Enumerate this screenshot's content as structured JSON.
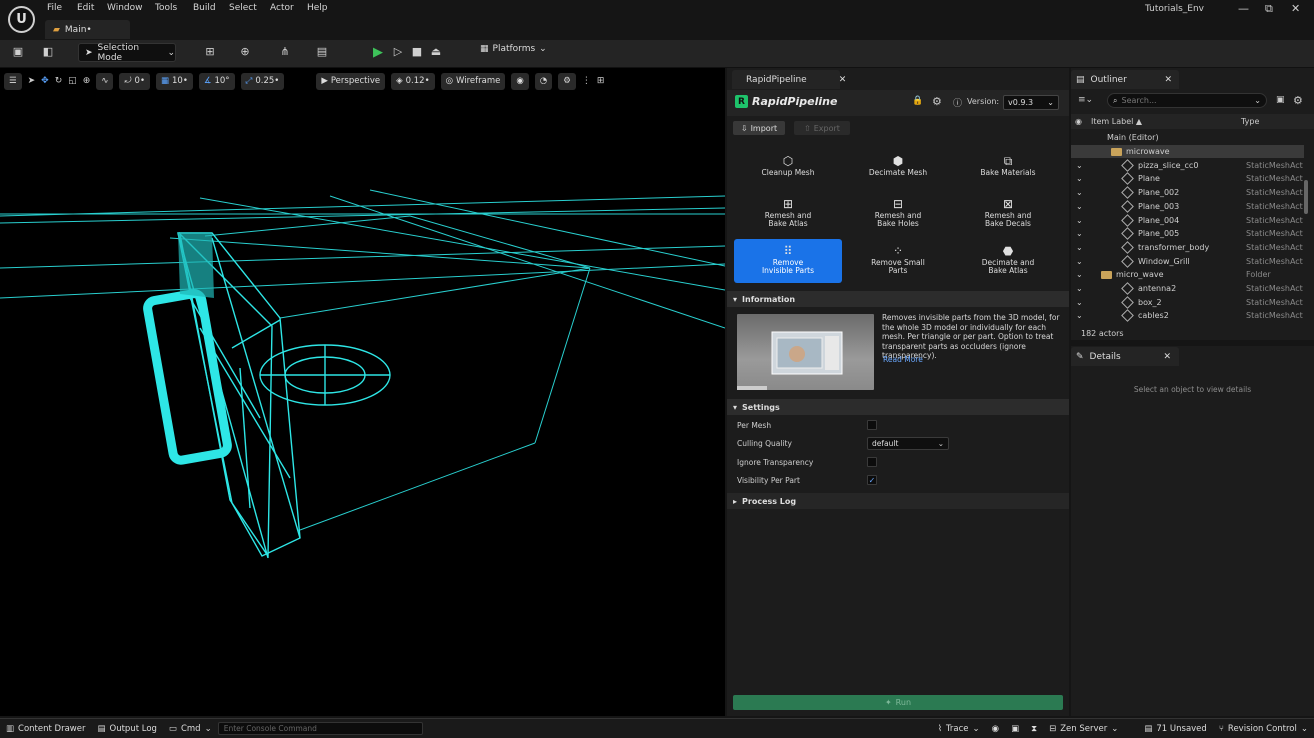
{
  "menu": [
    "File",
    "Edit",
    "Window",
    "Tools",
    "Build",
    "Select",
    "Actor",
    "Help"
  ],
  "window_title": "Tutorials_Env",
  "level_tab": "Main•",
  "toolbar": {
    "selection_mode": "Selection Mode",
    "platforms": "Platforms"
  },
  "viewport_bar": {
    "rotate_snap": "0•",
    "grid_snap": "10•",
    "angle_snap": "10°",
    "scale_snap": "0.25•",
    "view": "Perspective",
    "fov": "0.12•",
    "view_mode": "Wireframe"
  },
  "rapidpipeline": {
    "tab": "RapidPipeline",
    "logo": "RapidPipeline",
    "version_label": "Version:",
    "version": "v0.9.3",
    "import": "Import",
    "export": "Export",
    "tools": [
      {
        "label": "Cleanup Mesh",
        "icon": "cleanup-mesh-icon"
      },
      {
        "label": "Decimate Mesh",
        "icon": "decimate-mesh-icon"
      },
      {
        "label": "Bake Materials",
        "icon": "bake-materials-icon"
      },
      {
        "label": "Remesh and Bake Atlas",
        "icon": "remesh-atlas-icon"
      },
      {
        "label": "Remesh and Bake Holes",
        "icon": "remesh-holes-icon"
      },
      {
        "label": "Remesh and Bake Decals",
        "icon": "remesh-decals-icon"
      },
      {
        "label": "Remove Invisible Parts",
        "icon": "remove-invisible-icon"
      },
      {
        "label": "Remove Small Parts",
        "icon": "remove-small-icon"
      },
      {
        "label": "Decimate and Bake Atlas",
        "icon": "decimate-atlas-icon"
      }
    ],
    "information_title": "Information",
    "information_text": "Removes invisible parts from the 3D model, for the whole 3D model or individually for each mesh. Per triangle or per part. Option to treat transparent parts as occluders (ignore transparency).",
    "read_more": "Read More",
    "settings_title": "Settings",
    "settings": {
      "per_mesh": "Per Mesh",
      "culling_quality": "Culling Quality",
      "culling_value": "default",
      "ignore_transparency": "Ignore Transparency",
      "visibility_per_part": "Visibility Per Part"
    },
    "process_log": "Process Log",
    "run": "Run"
  },
  "outliner": {
    "tab": "Outliner",
    "search_placeholder": "Search...",
    "col_label": "Item Label ▲",
    "col_type": "Type",
    "rows": [
      {
        "name": "Main (Editor)",
        "type": "",
        "kind": "root"
      },
      {
        "name": "microwave",
        "type": "",
        "kind": "folder-sel"
      },
      {
        "name": "pizza_slice_cc0",
        "type": "StaticMeshAct",
        "kind": "mesh"
      },
      {
        "name": "Plane",
        "type": "StaticMeshAct",
        "kind": "mesh"
      },
      {
        "name": "Plane_002",
        "type": "StaticMeshAct",
        "kind": "mesh"
      },
      {
        "name": "Plane_003",
        "type": "StaticMeshAct",
        "kind": "mesh"
      },
      {
        "name": "Plane_004",
        "type": "StaticMeshAct",
        "kind": "mesh"
      },
      {
        "name": "Plane_005",
        "type": "StaticMeshAct",
        "kind": "mesh"
      },
      {
        "name": "transformer_body",
        "type": "StaticMeshAct",
        "kind": "mesh"
      },
      {
        "name": "Window_Grill",
        "type": "StaticMeshAct",
        "kind": "mesh"
      },
      {
        "name": "micro_wave",
        "type": "Folder",
        "kind": "folder"
      },
      {
        "name": "antenna2",
        "type": "StaticMeshAct",
        "kind": "mesh"
      },
      {
        "name": "box_2",
        "type": "StaticMeshAct",
        "kind": "mesh"
      },
      {
        "name": "cables2",
        "type": "StaticMeshAct",
        "kind": "mesh"
      }
    ],
    "actor_count": "182 actors"
  },
  "details": {
    "tab": "Details",
    "empty_message": "Select an object to view details"
  },
  "statusbar": {
    "content_drawer": "Content Drawer",
    "output_log": "Output Log",
    "cmd": "Cmd",
    "console_placeholder": "Enter Console Command",
    "trace": "Trace",
    "zen": "Zen Server",
    "unsaved": "71 Unsaved",
    "revision": "Revision Control"
  },
  "colors": {
    "accent": "#1a73e8",
    "wire": "#2ee6e6",
    "run": "#2b7a52"
  }
}
